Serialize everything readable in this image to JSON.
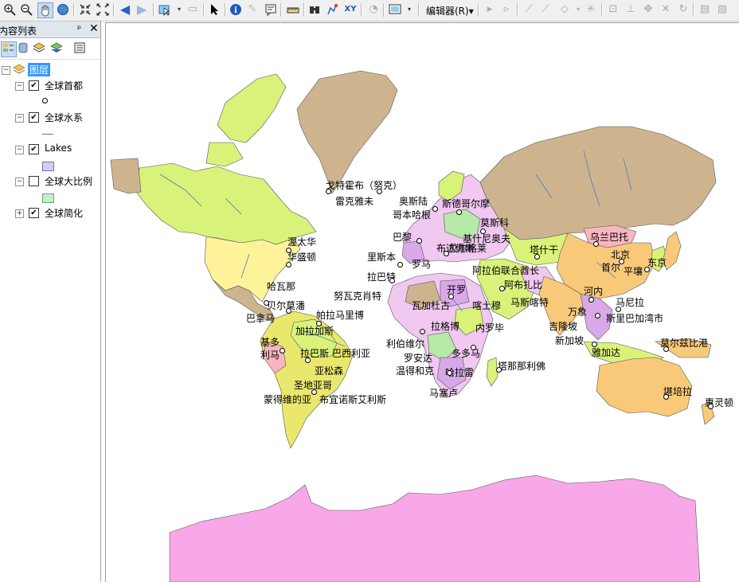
{
  "toolbar": {
    "editor_menu": "编辑器(R)▾",
    "buttons": [
      "zoom-in-icon",
      "zoom-out-icon",
      "pan-icon",
      "full-extent-icon",
      "fixed-zoom-in-icon",
      "fixed-zoom-out-icon",
      "back-icon",
      "forward-icon",
      "select-features-icon",
      "select-elements-icon",
      "identify-icon",
      "html-popup-icon",
      "hyperlink-icon",
      "measure-icon",
      "find-icon",
      "find-route-icon",
      "go-to-xy-icon",
      "map-view-icon",
      "layout-view-icon"
    ]
  },
  "toc": {
    "title": "内容列表",
    "pin": "ᵖ",
    "close": "✕",
    "root_label": "图层",
    "layers": [
      {
        "name": "全球首都",
        "checked": true,
        "symbol": "point"
      },
      {
        "name": "全球水系",
        "checked": true,
        "symbol": "line"
      },
      {
        "name": "Lakes",
        "checked": true,
        "symbol": "fill-lavender"
      },
      {
        "name": "全球大比例",
        "checked": false,
        "symbol": "fill-green"
      },
      {
        "name": "全球简化",
        "checked": true,
        "symbol": "none"
      }
    ]
  },
  "map": {
    "colors": {
      "land": "#cdb48f",
      "ocean": "#ffffff",
      "antarctica": "#f8a8e8",
      "canada": "#d9f27a",
      "usa": "#fff39a",
      "brazil": "#e9e86c",
      "russia": "#cdb48f",
      "china": "#f9c97a",
      "australia": "#f9c97a",
      "africa": "#d8a8e8"
    },
    "cities": [
      {
        "name": "戈特霍布（努克）"
      },
      {
        "name": "雷克雅未"
      },
      {
        "name": "奥斯陆"
      },
      {
        "name": "斯德哥尔摩"
      },
      {
        "name": "哥本哈根"
      },
      {
        "name": "莫斯科"
      },
      {
        "name": "巴黎"
      },
      {
        "name": "布达佩斯"
      },
      {
        "name": "基什尼奥夫"
      },
      {
        "name": "贝尔格莱"
      },
      {
        "name": "塔什干"
      },
      {
        "name": "乌兰巴托"
      },
      {
        "name": "渥太华"
      },
      {
        "name": "华盛顿"
      },
      {
        "name": "里斯本"
      },
      {
        "name": "罗马"
      },
      {
        "name": "北京"
      },
      {
        "name": "首尔"
      },
      {
        "name": "东京"
      },
      {
        "name": "平壤"
      },
      {
        "name": "拉巴特"
      },
      {
        "name": "阿拉伯联合酋长"
      },
      {
        "name": "开罗"
      },
      {
        "name": "阿布扎比"
      },
      {
        "name": "哈瓦那"
      },
      {
        "name": "努瓦克肖特"
      },
      {
        "name": "贝尔莫潘"
      },
      {
        "name": "瓦加杜古"
      },
      {
        "name": "喀土穆"
      },
      {
        "name": "马斯喀特"
      },
      {
        "name": "河内"
      },
      {
        "name": "马尼拉"
      },
      {
        "name": "巴拿马"
      },
      {
        "name": "帕拉马里博"
      },
      {
        "name": "万象"
      },
      {
        "name": "加拉加斯"
      },
      {
        "name": "拉格博"
      },
      {
        "name": "内罗毕"
      },
      {
        "name": "吉隆坡"
      },
      {
        "name": "斯里巴加湾市"
      },
      {
        "name": "基多"
      },
      {
        "name": "利伯维尔"
      },
      {
        "name": "新加坡"
      },
      {
        "name": "利马"
      },
      {
        "name": "拉巴斯"
      },
      {
        "name": "巴西利亚"
      },
      {
        "name": "罗安达"
      },
      {
        "name": "多多马"
      },
      {
        "name": "雅加达"
      },
      {
        "name": "莫尔兹比港"
      },
      {
        "name": "亚松森"
      },
      {
        "name": "温得和克"
      },
      {
        "name": "哈拉雷"
      },
      {
        "name": "塔那那利佛"
      },
      {
        "name": "圣地亚哥"
      },
      {
        "name": "马塞卢"
      },
      {
        "name": "堪培拉"
      },
      {
        "name": "蒙得维的亚"
      },
      {
        "name": "布宜诺斯艾利斯"
      },
      {
        "name": "惠灵顿"
      }
    ]
  }
}
